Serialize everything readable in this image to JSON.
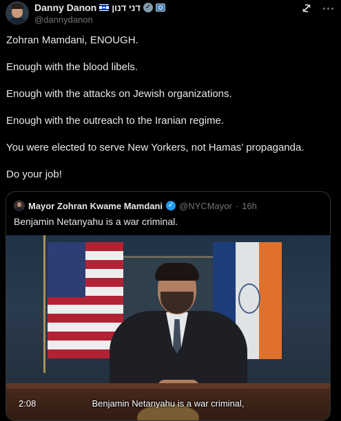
{
  "author": {
    "display_name": "Danny Danon",
    "hebrew_name": "דני דנון",
    "handle": "@dannydanon"
  },
  "tweet": {
    "paragraphs": [
      "Zohran Mamdani, ENOUGH.",
      "Enough with the blood libels.",
      "Enough with the attacks on Jewish organizations.",
      "Enough with the outreach to the Iranian regime.",
      "You were elected to serve New Yorkers, not Hamas’ propaganda.",
      "Do your job!"
    ]
  },
  "quoted": {
    "name": "Mayor Zohran Kwame Mamdani",
    "handle": "@NYCMayor",
    "separator": "·",
    "time": "16h",
    "text": "Benjamin Netanyahu is a war criminal.",
    "video": {
      "duration": "2:08",
      "caption": "Benjamin Netanyahu is a war criminal,"
    }
  },
  "icons": {
    "grok": "grok-icon",
    "more": "more-icon",
    "verified_gray": "verified-gray-icon",
    "verified_blue": "verified-blue-icon"
  },
  "colors": {
    "background": "#000000",
    "text": "#e7e9ea",
    "muted": "#71767b",
    "verified_blue": "#1d9bf0",
    "border": "#2f3336"
  }
}
